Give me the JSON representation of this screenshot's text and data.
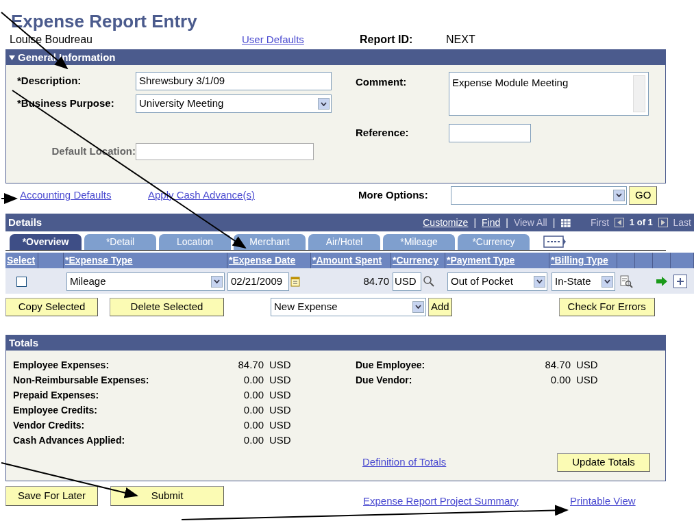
{
  "page_title": "Expense Report Entry",
  "employee_name": "Louise Boudreau",
  "user_defaults_link": "User Defaults",
  "report_id": {
    "label": "Report ID:",
    "value": "NEXT"
  },
  "general_information": {
    "title": "General Information",
    "expanded": true,
    "description": {
      "label": "*Description:",
      "value": "Shrewsbury 3/1/09"
    },
    "business_purpose": {
      "label": "*Business Purpose:",
      "value": "University Meeting"
    },
    "default_location": {
      "label": "Default Location:"
    },
    "comment": {
      "label": "Comment:",
      "value": "Expense Module Meeting"
    },
    "reference": {
      "label": "Reference:"
    }
  },
  "links": [
    "Accounting Defaults",
    "Apply Cash Advance(s)"
  ],
  "more_options": {
    "label": "More Options:",
    "button": "GO"
  },
  "details": {
    "title": "Details",
    "nav_links": [
      "Customize",
      "Find"
    ],
    "view_all": "View All",
    "separators": [
      "|",
      "|",
      "|"
    ],
    "first": "First",
    "count": "1 of 1",
    "last": "Last",
    "tabs": [
      {
        "label": "*Overview",
        "selected": true
      },
      {
        "label": "*Detail",
        "selected": false
      },
      {
        "label": "Location",
        "selected": false
      },
      {
        "label": "Merchant",
        "selected": false
      },
      {
        "label": "Air/Hotel",
        "selected": false
      },
      {
        "label": "*Mileage",
        "selected": false
      },
      {
        "label": "*Currency",
        "selected": false
      }
    ],
    "columns": [
      "Select",
      "*Expense Type",
      "*Expense Date",
      "*Amount Spent",
      "*Currency",
      "*Payment Type",
      "*Billing Type"
    ],
    "rows": [
      {
        "selected": false,
        "expense_type": "Mileage",
        "expense_date": "02/21/2009",
        "amount": "84.70",
        "currency": "USD",
        "payment_type": "Out of Pocket",
        "billing_type": "In-State"
      }
    ],
    "buttons": [
      "Copy Selected",
      "Delete Selected"
    ],
    "new_expense": "New Expense",
    "add": "Add",
    "check_errors": "Check For Errors"
  },
  "totals": {
    "title": "Totals",
    "left": [
      {
        "label": "Employee Expenses:",
        "amount": "84.70",
        "currency": "USD"
      },
      {
        "label": "Non-Reimbursable Expenses:",
        "amount": "0.00",
        "currency": "USD"
      },
      {
        "label": "Prepaid Expenses:",
        "amount": "0.00",
        "currency": "USD"
      },
      {
        "label": "Employee Credits:",
        "amount": "0.00",
        "currency": "USD"
      },
      {
        "label": "Vendor Credits:",
        "amount": "0.00",
        "currency": "USD"
      },
      {
        "label": "Cash Advances Applied:",
        "amount": "0.00",
        "currency": "USD"
      }
    ],
    "right": [
      {
        "label": "Due Employee:",
        "amount": "84.70",
        "currency": "USD"
      },
      {
        "label": "Due Vendor:",
        "amount": "0.00",
        "currency": "USD"
      }
    ],
    "definition_link": "Definition of Totals",
    "update_button": "Update Totals"
  },
  "footer": {
    "buttons": [
      "Save For Later",
      "Submit"
    ],
    "links": [
      "Expense Report Project Summary",
      "Printable View"
    ]
  }
}
